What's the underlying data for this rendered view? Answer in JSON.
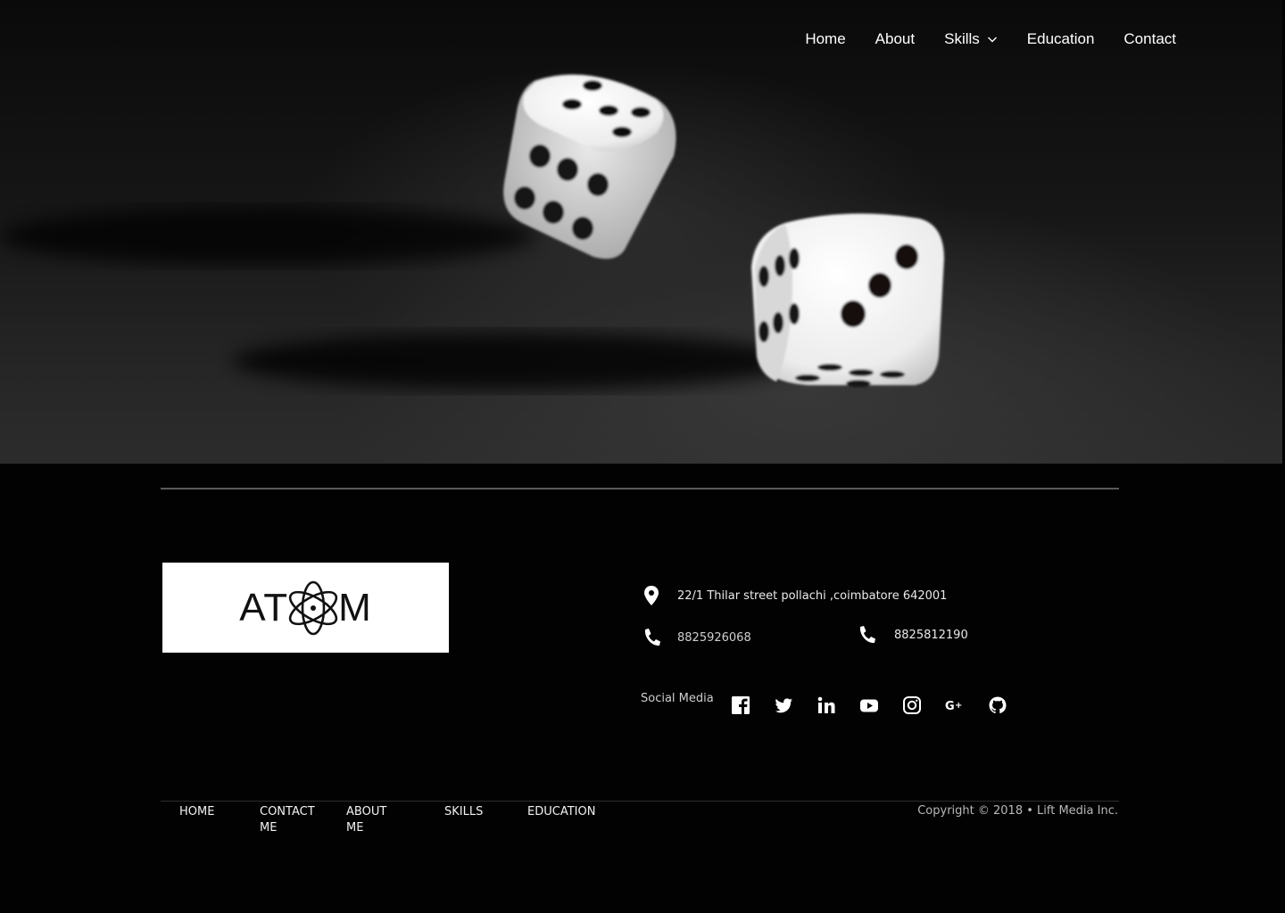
{
  "nav": {
    "items": [
      {
        "label": "Home"
      },
      {
        "label": "About"
      },
      {
        "label": "Skills",
        "has_dropdown": true
      },
      {
        "label": "Education"
      },
      {
        "label": "Contact"
      }
    ]
  },
  "hero": {
    "image": "photo of two white dice on a dark surface"
  },
  "logo": {
    "text_left": "AT",
    "text_right": "M",
    "icon": "atom-icon"
  },
  "contact": {
    "address": "22/1 Thilar street pollachi ,coimbatore  642001",
    "phone_1": "8825926068",
    "phone_2": "8825812190",
    "address_icon": "location-pin-icon",
    "phone_icon": "phone-icon"
  },
  "social": {
    "label": "Social Media",
    "icons": [
      "facebook-icon",
      "twitter-icon",
      "linkedin-icon",
      "youtube-icon",
      "instagram-icon",
      "google-plus-icon",
      "github-icon"
    ]
  },
  "footer": {
    "nav": [
      {
        "label": "HOME"
      },
      {
        "label": "CONTACT ME"
      },
      {
        "label": "ABOUT ME"
      },
      {
        "label": "SKILLS"
      },
      {
        "label": "EDUCATION"
      }
    ],
    "copyright": "Copyright © 2018 • Lift Media Inc."
  },
  "colors": {
    "background": "#020203",
    "text": "#ffffff",
    "divider": "#5a5a5a"
  }
}
